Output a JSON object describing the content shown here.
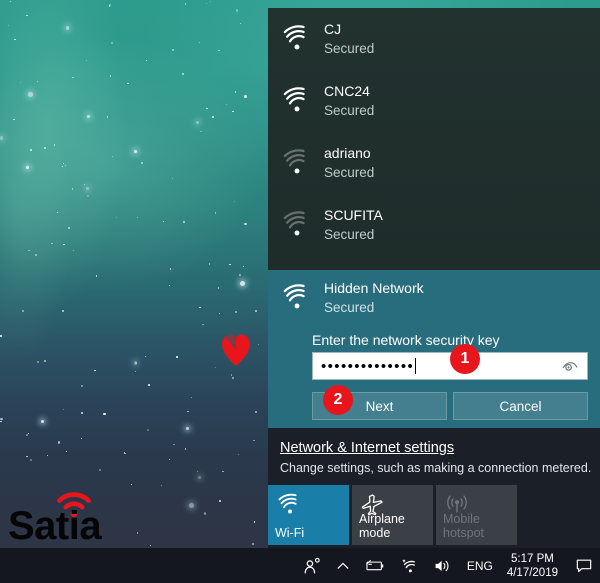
{
  "desktop": {
    "wallpaper_name": "teal-nebula-wallpaper",
    "watermark": {
      "text": "Satia",
      "icon": "wifi-arc-icon",
      "icon_color": "#e8161c"
    },
    "cursor_annotation": {
      "shape": "heart-cursor",
      "color": "#e8161c"
    }
  },
  "flyout": {
    "networks": [
      {
        "name": "CJ",
        "status": "Secured",
        "icon": "wifi-signal-icon",
        "strength": 3
      },
      {
        "name": "CNC24",
        "status": "Secured",
        "icon": "wifi-signal-icon",
        "strength": 3
      },
      {
        "name": "adriano",
        "status": "Secured",
        "icon": "wifi-signal-icon",
        "strength": 1
      },
      {
        "name": "SCUFITA",
        "status": "Secured",
        "icon": "wifi-signal-icon",
        "strength": 1
      }
    ],
    "selected_network": {
      "name": "Hidden Network",
      "status": "Secured",
      "icon": "wifi-signal-icon",
      "prompt": "Enter the network security key",
      "password_value": "••••••••••••••",
      "password_char_count": 14,
      "show_password_icon": "eye-icon",
      "next_label": "Next",
      "cancel_label": "Cancel",
      "background_color": "#286d7e"
    },
    "footer": {
      "settings_link": "Network & Internet settings",
      "settings_description": "Change settings, such as making a connection metered.",
      "tiles": [
        {
          "label": "Wi-Fi",
          "icon": "wifi-icon",
          "state": "on",
          "color": "#1a7fa8"
        },
        {
          "label": "Airplane mode",
          "icon": "airplane-icon",
          "state": "off",
          "color": "#3b3f46"
        },
        {
          "label": "Mobile hotspot",
          "icon": "hotspot-icon",
          "state": "disabled",
          "color": "#3b3f46"
        }
      ]
    }
  },
  "annotations": [
    {
      "number": "1",
      "target": "password-input"
    },
    {
      "number": "2",
      "target": "next-button"
    }
  ],
  "taskbar": {
    "tray_icons": [
      {
        "name": "people-icon"
      },
      {
        "name": "chevron-up-icon"
      },
      {
        "name": "battery-icon"
      },
      {
        "name": "wifi-tray-icon"
      },
      {
        "name": "volume-icon"
      }
    ],
    "language": "ENG",
    "time": "5:17 PM",
    "date": "4/17/2019",
    "action_center_icon": "notification-icon"
  }
}
